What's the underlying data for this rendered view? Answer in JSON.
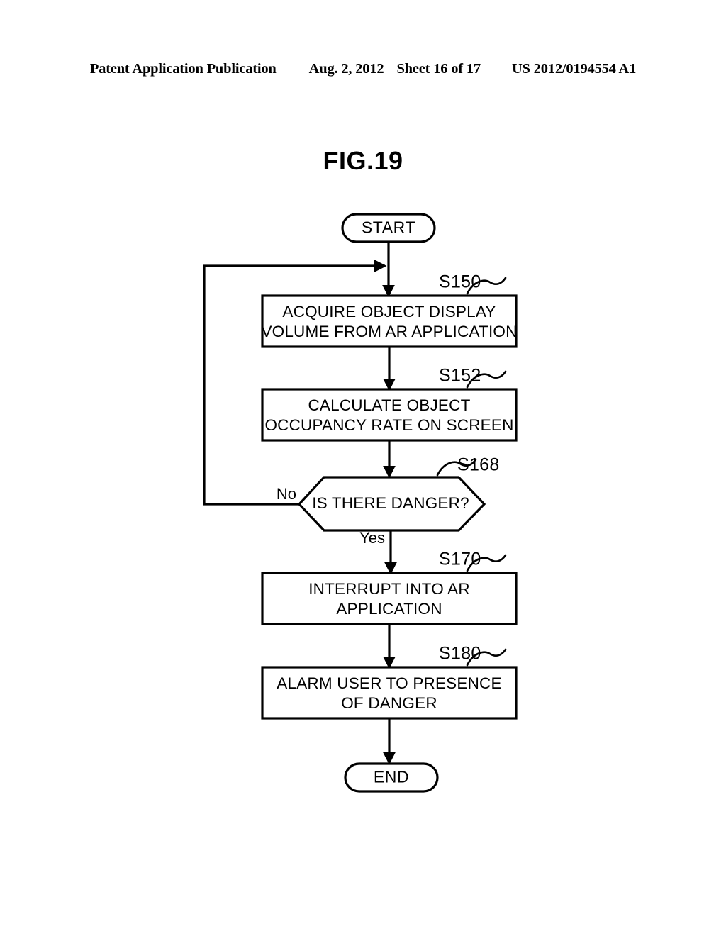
{
  "header": {
    "publication": "Patent Application Publication",
    "date": "Aug. 2, 2012",
    "sheet": "Sheet 16 of 17",
    "number": "US 2012/0194554 A1"
  },
  "figure": {
    "title": "FIG.19"
  },
  "flowchart": {
    "start_label": "START",
    "end_label": "END",
    "branch_no": "No",
    "branch_yes": "Yes",
    "steps": [
      {
        "id": "S150",
        "line1": "ACQUIRE OBJECT DISPLAY",
        "line2": "VOLUME FROM AR APPLICATION"
      },
      {
        "id": "S152",
        "line1": "CALCULATE OBJECT",
        "line2": "OCCUPANCY RATE ON SCREEN"
      },
      {
        "id": "S168",
        "line1": "IS THERE DANGER?",
        "line2": ""
      },
      {
        "id": "S170",
        "line1": "INTERRUPT INTO AR",
        "line2": "APPLICATION"
      },
      {
        "id": "S180",
        "line1": "ALARM USER TO PRESENCE",
        "line2": "OF DANGER"
      }
    ]
  },
  "colors": {
    "ink": "#000000",
    "paper": "#ffffff"
  }
}
